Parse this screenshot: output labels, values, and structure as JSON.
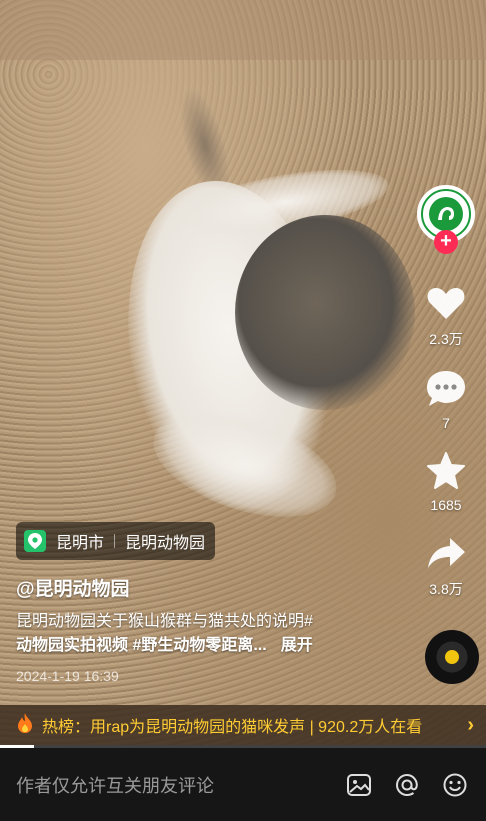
{
  "video": {
    "progress_fraction": 0.07
  },
  "author": {
    "handle": "@昆明动物园"
  },
  "actions": {
    "likes": "2.3万",
    "comments": "7",
    "favorites": "1685",
    "shares": "3.8万"
  },
  "location": {
    "city": "昆明市",
    "place": "昆明动物园"
  },
  "description": {
    "text": "昆明动物园关于猴山猴群与猫共处的说明#",
    "tags": "动物园实拍视频 #野生动物零距离...",
    "expand": "展开"
  },
  "date": "2024-1-19 16:39",
  "hot": {
    "text": "热榜：用rap为昆明动物园的猫咪发声 | 920.2万人在看"
  },
  "comment_bar": {
    "placeholder": "作者仅允许互关朋友评论"
  },
  "icons": {
    "follow": "plus-icon",
    "like": "heart-icon",
    "comment": "comment-bubble-icon",
    "favorite": "star-icon",
    "share": "share-arrow-icon",
    "music": "music-disc-icon",
    "hot": "flame-icon",
    "image": "image-icon",
    "mention": "at-icon",
    "emoji": "emoji-icon"
  },
  "colors": {
    "accent": "#fe2c55",
    "hot_text": "#ffcc33",
    "location_pin": "#24c26a"
  }
}
